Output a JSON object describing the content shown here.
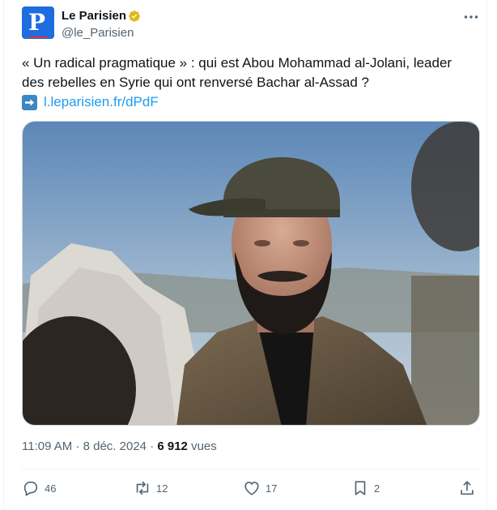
{
  "author": {
    "name": "Le Parisien",
    "handle": "@le_Parisien",
    "avatar_letter": "P"
  },
  "tweet": {
    "text": "« Un radical pragmatique » : qui est Abou Mohammad al-Jolani, leader des rebelles en Syrie qui ont renversé Bachar al-Assad ?",
    "link": "l.leparisien.fr/dPdF"
  },
  "meta": {
    "time": "11:09 AM",
    "separator": "·",
    "date": "8 déc. 2024",
    "views_count": "6 912",
    "views_label": "vues"
  },
  "actions": {
    "replies": "46",
    "reposts": "12",
    "likes": "17",
    "bookmarks": "2"
  },
  "colors": {
    "accent": "#1d9bf0",
    "brand": "#1d6ce0",
    "muted": "#536471",
    "verified": "#e2b719"
  },
  "icons": [
    "verified-badge-icon",
    "more-options-icon",
    "arrow-right-icon",
    "reply-icon",
    "repost-icon",
    "like-icon",
    "bookmark-icon",
    "share-icon"
  ]
}
